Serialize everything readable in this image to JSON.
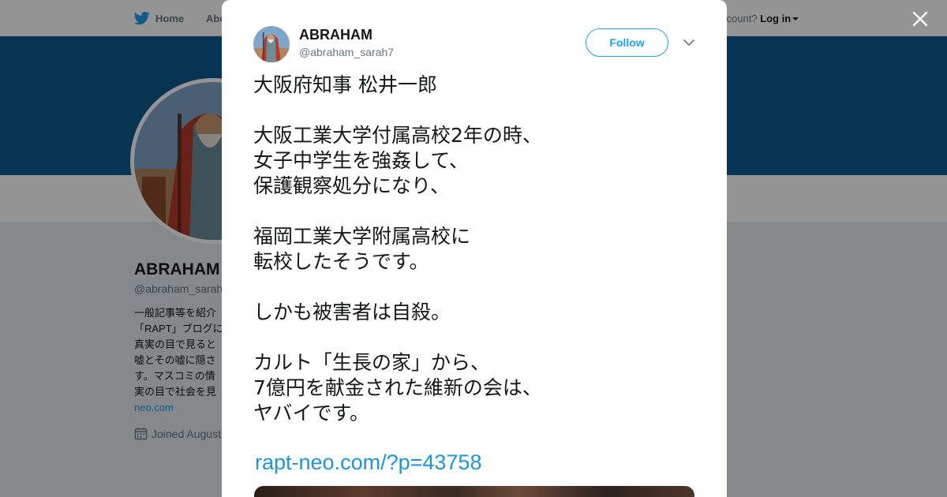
{
  "topbar": {
    "home_label": "Home",
    "about_label": "Abo",
    "login_prefix": "ccount?",
    "login_label": "Log in"
  },
  "colors": {
    "brand": "#1da1f2",
    "banner": "#0f5a8f",
    "link": "#1b95e0",
    "text": "#14171a",
    "muted": "#657786"
  },
  "profile": {
    "name": "ABRAHAM",
    "handle": "@abraham_sarah",
    "bio_lines": [
      "一般記事等を紹介",
      "「RAPT」ブログに",
      "真実の目で見ると",
      "嘘とその嘘に隠さ",
      "す。マスコミの情",
      "実の目で社会を見"
    ],
    "bio_link": "neo.com",
    "joined": "Joined August"
  },
  "tweet": {
    "name": "ABRAHAM",
    "handle": "@abraham_sarah7",
    "follow_label": "Follow",
    "text": "大阪府知事 松井一郎\n\n大阪工業大学付属高校2年の時、\n女子中学生を強姦して、\n保護観察処分になり、\n\n福岡工業大学附属高校に\n転校したそうです。\n\nしかも被害者は自殺。\n\nカルト「生長の家」から、\n7億円を献金された維新の会は、\nヤバイです。",
    "link": "rapt-neo.com/?p=43758"
  },
  "icons": {
    "brand": "twitter-bird-icon",
    "calendar": "calendar-icon",
    "close": "close-icon",
    "chevron": "chevron-down-icon"
  }
}
